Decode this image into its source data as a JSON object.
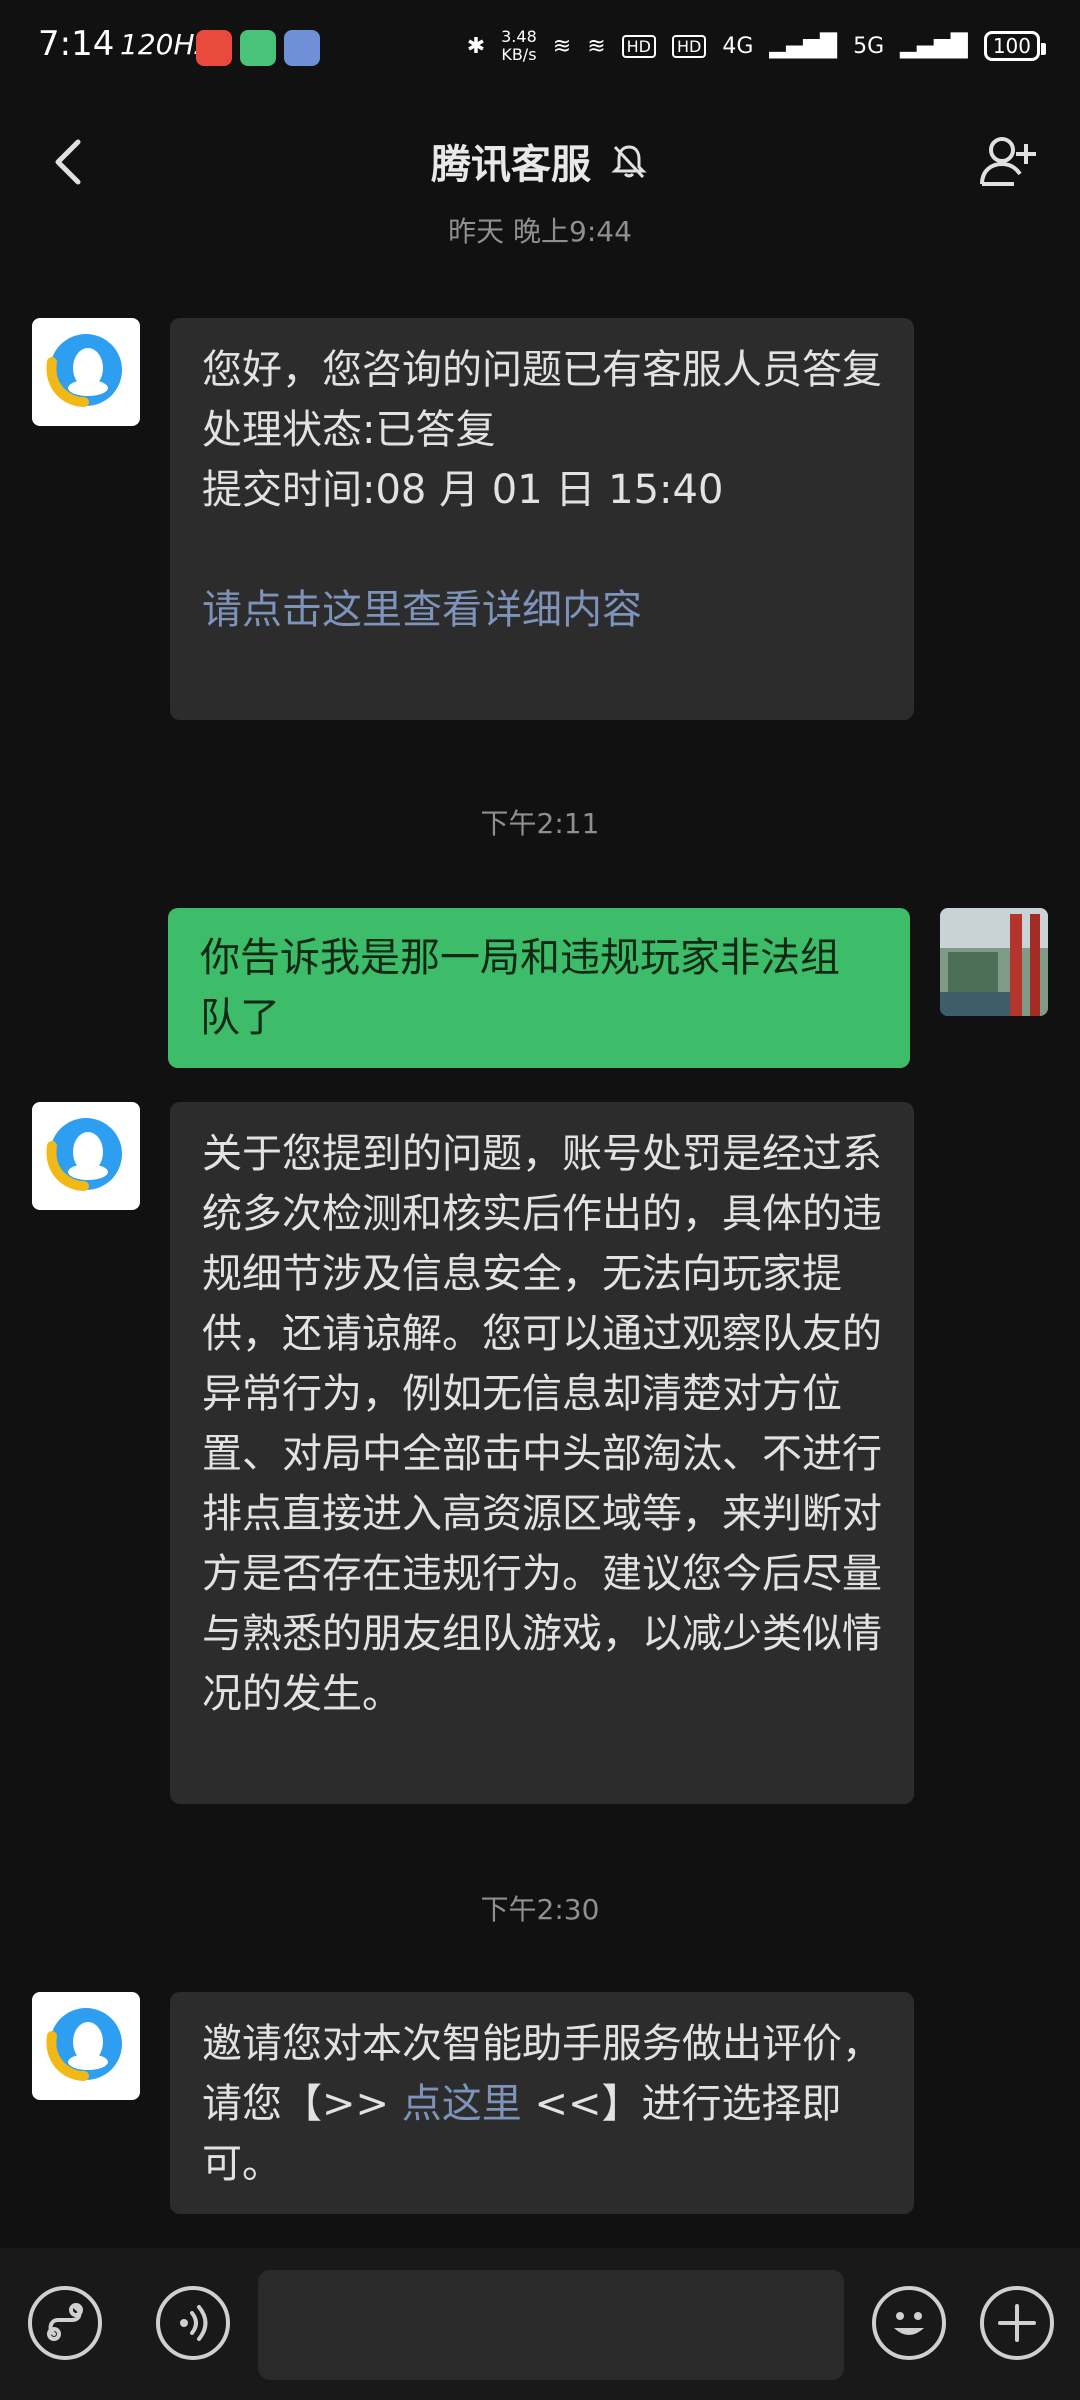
{
  "status_bar": {
    "time": "7:14",
    "refresh_rate": "120Hz",
    "speed_value": "3.48",
    "speed_unit": "KB/s",
    "net1": "4G",
    "net2": "5G",
    "hd": "HD",
    "battery": "100"
  },
  "header": {
    "title": "腾讯客服"
  },
  "messages": {
    "prev_time": "昨天 晚上9:44",
    "m1_line1": "您好，您咨询的问题已有客服人员答复",
    "m1_line2": "处理状态:已答复",
    "m1_line3": "提交时间:08 月 01 日 15:40",
    "m1_link": "请点击这里查看详细内容",
    "ts1": "下午2:11",
    "m2": "你告诉我是那一局和违规玩家非法组队了",
    "m3": "关于您提到的问题，账号处罚是经过系统多次检测和核实后作出的，具体的违规细节涉及信息安全，无法向玩家提供，还请谅解。您可以通过观察队友的异常行为，例如无信息却清楚对方位置、对局中全部击中头部淘汰、不进行排点直接进入高资源区域等，来判断对方是否存在违规行为。建议您今后尽量与熟悉的朋友组队游戏，以减少类似情况的发生。",
    "ts2": "下午2:30",
    "m4_pre": "邀请您对本次智能助手服务做出评价，请您【>> ",
    "m4_link": "点这里",
    "m4_post": " <<】进行选择即可。"
  },
  "input_bar": {
    "placeholder": ""
  }
}
